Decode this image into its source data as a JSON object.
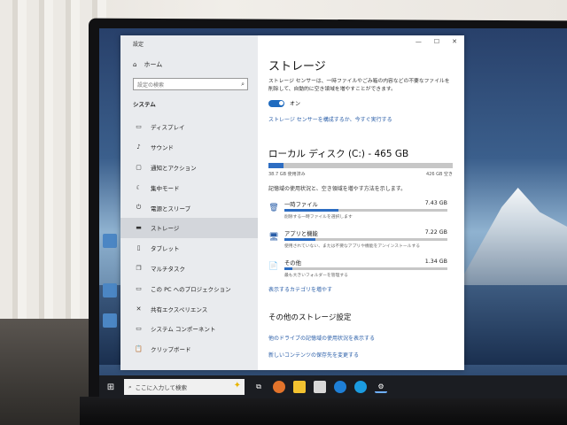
{
  "window": {
    "title": "設定",
    "controls": [
      "—",
      "☐",
      "✕"
    ]
  },
  "sidebar": {
    "home_label": "ホーム",
    "search_placeholder": "設定の検索",
    "section_label": "システム",
    "items": [
      {
        "label": "ディスプレイ",
        "icon": "display-icon"
      },
      {
        "label": "サウンド",
        "icon": "sound-icon"
      },
      {
        "label": "通知とアクション",
        "icon": "notification-icon"
      },
      {
        "label": "集中モード",
        "icon": "focus-icon"
      },
      {
        "label": "電源とスリープ",
        "icon": "power-icon"
      },
      {
        "label": "ストレージ",
        "icon": "storage-icon",
        "active": true
      },
      {
        "label": "タブレット",
        "icon": "tablet-icon"
      },
      {
        "label": "マルチタスク",
        "icon": "multitask-icon"
      },
      {
        "label": "この PC へのプロジェクション",
        "icon": "projection-icon"
      },
      {
        "label": "共有エクスペリエンス",
        "icon": "share-icon"
      },
      {
        "label": "システム コンポーネント",
        "icon": "components-icon"
      },
      {
        "label": "クリップボード",
        "icon": "clipboard-icon"
      }
    ]
  },
  "main": {
    "title": "ストレージ",
    "sense_description": "ストレージ センサーは、一時ファイルやごみ箱の内容などの不要なファイルを削除して、自動的に空き領域を増やすことができます。",
    "toggle_state": "オン",
    "config_link": "ストレージ センサーを構成するか、今すぐ実行する",
    "drive": {
      "title": "ローカル ディスク (C:) - 465 GB",
      "used_label": "38.7 GB 使用済み",
      "free_label": "426 GB 空き",
      "used_fraction": 0.083,
      "description": "記憶域の使用状況と、空き領域を増やす方法を示します。"
    },
    "categories": [
      {
        "name": "一時ファイル",
        "size": "7.43 GB",
        "fraction": 0.33,
        "desc": "削除する一時ファイルを選択します",
        "icon": "trash-icon"
      },
      {
        "name": "アプリと機能",
        "size": "7.22 GB",
        "fraction": 0.19,
        "desc": "使用されていない、または不要なアプリや機能をアンインストールする",
        "icon": "apps-icon"
      },
      {
        "name": "その他",
        "size": "1.34 GB",
        "fraction": 0.05,
        "desc": "最も大きいフォルダーを管理する",
        "icon": "folder-icon"
      }
    ],
    "more_categories_link": "表示するカテゴリを増やす",
    "other_settings_title": "その他のストレージ設定",
    "other_links": [
      "他のドライブの記憶域の使用状況を表示する",
      "新しいコンテンツの保存先を変更する"
    ]
  },
  "taskbar": {
    "search_placeholder": "ここに入力して検索"
  },
  "colors": {
    "accent": "#2d6dc2",
    "link": "#2a5ea8",
    "sidebar_bg": "#e9ebee",
    "taskbar_bg": "#1b1d22"
  }
}
